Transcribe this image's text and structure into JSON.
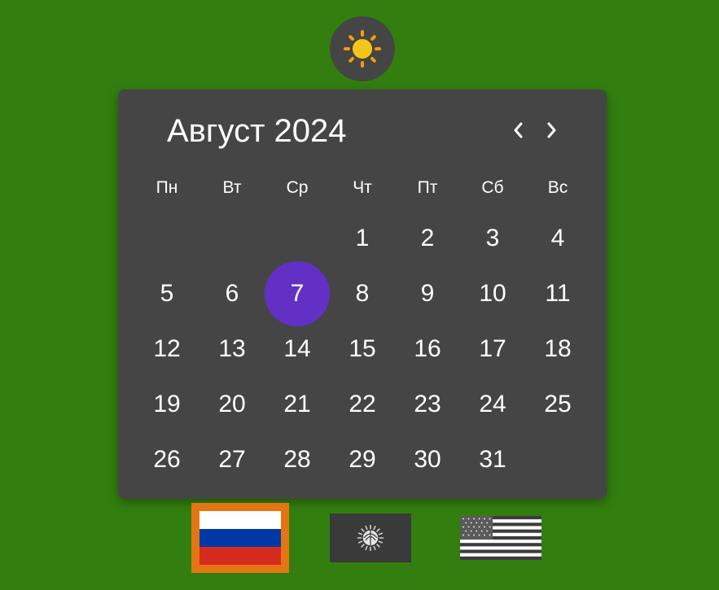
{
  "colors": {
    "page_background": "#327f0f",
    "panel_background": "#454545",
    "selected_day": "#6330c6",
    "active_language_border": "#e57512",
    "sun": "#f5c518",
    "text": "#ffffff"
  },
  "theme_toggle": {
    "icon": "sun-icon"
  },
  "calendar": {
    "title": "Август 2024",
    "nav": {
      "prev_icon": "chevron-left-icon",
      "next_icon": "chevron-right-icon"
    },
    "weekdays": [
      "Пн",
      "Вт",
      "Ср",
      "Чт",
      "Пт",
      "Сб",
      "Вс"
    ],
    "days": [
      "1",
      "2",
      "3",
      "4",
      "5",
      "6",
      "7",
      "8",
      "9",
      "10",
      "11",
      "12",
      "13",
      "14",
      "15",
      "16",
      "17",
      "18",
      "19",
      "20",
      "21",
      "22",
      "23",
      "24",
      "25",
      "26",
      "27",
      "28",
      "29",
      "30",
      "31"
    ],
    "selected_day": "7"
  },
  "languages": {
    "active": "ru",
    "items": [
      {
        "code": "ru",
        "icon": "russia-flag-icon"
      },
      {
        "code": "kg",
        "icon": "kyrgyzstan-flag-icon"
      },
      {
        "code": "us",
        "icon": "usa-flag-icon"
      }
    ]
  }
}
